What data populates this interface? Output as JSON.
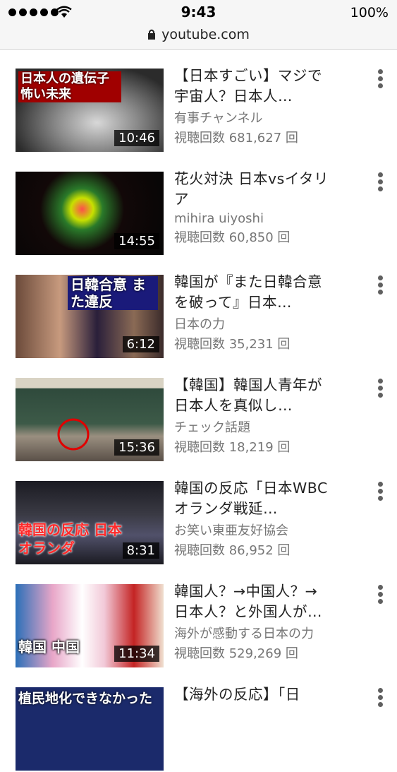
{
  "status": {
    "time": "9:43",
    "battery": "100%"
  },
  "browser": {
    "url": "youtube.com"
  },
  "videos": [
    {
      "title": "【日本すごい】マジで宇宙人？日本人…",
      "channel": "有事チャンネル",
      "views": "視聴回数 681,627 回",
      "duration": "10:46",
      "overlay": "日本人の遺伝子 怖い未来"
    },
    {
      "title": "花火対決 日本vsイタリア",
      "channel": "mihira uiyoshi",
      "views": "視聴回数 60,850 回",
      "duration": "14:55",
      "overlay": ""
    },
    {
      "title": "韓国が『また日韓合意を破って』日本…",
      "channel": "日本の力",
      "views": "視聴回数 35,231 回",
      "duration": "6:12",
      "overlay": "日韓合意 また違反"
    },
    {
      "title": "【韓国】韓国人青年が日本人を真似し…",
      "channel": "チェック話題",
      "views": "視聴回数 18,219 回",
      "duration": "15:36",
      "overlay": ""
    },
    {
      "title": "韓国の反応「日本WBCオランダ戦延…",
      "channel": "お笑い東亜友好協会",
      "views": "視聴回数 86,952 回",
      "duration": "8:31",
      "overlay": "韓国の反応 日本オランダ"
    },
    {
      "title": "韓国人？→中国人？→日本人？と外国人が…",
      "channel": "海外が感動する日本の力",
      "views": "視聴回数 529,269 回",
      "duration": "11:34",
      "overlay": "韓国 中国"
    },
    {
      "title": "【海外の反応】「日",
      "channel": "",
      "views": "",
      "duration": "",
      "overlay": "植民地化できなかった"
    }
  ],
  "colors": {
    "overlay_red": "#b30000",
    "meta_grey": "#767676"
  }
}
